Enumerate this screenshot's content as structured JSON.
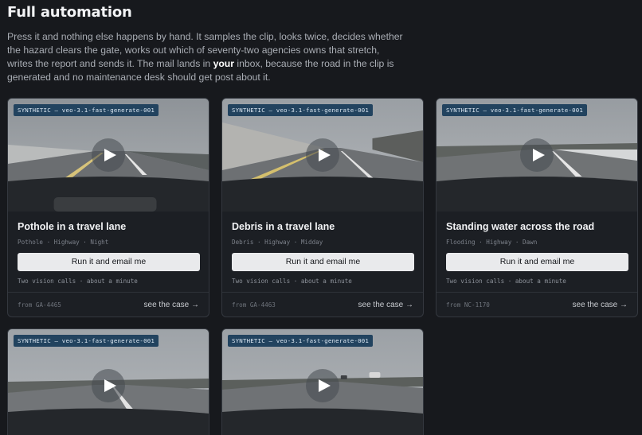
{
  "header": {
    "title": "Full automation",
    "intro_part1": "Press it and nothing else happens by hand. It samples the clip, looks twice, decides whether the hazard clears the gate, works out which of seventy-two agencies owns that stretch, writes the report and sends it. The mail lands in ",
    "intro_bold": "your",
    "intro_part2": " inbox, because the road in the clip is generated and no maintenance desk should get post about it."
  },
  "cards": [
    {
      "badge": "SYNTHETIC — veo-3.1-fast-generate-001",
      "title": "Pothole in a travel lane",
      "tags": "Pothole · Highway · Night",
      "button_label": "Run it and email me",
      "note": "Two vision calls · about a minute",
      "from": "from GA-4465",
      "case_label": "see the case →"
    },
    {
      "badge": "SYNTHETIC — veo-3.1-fast-generate-001",
      "title": "Debris in a travel lane",
      "tags": "Debris · Highway · Midday",
      "button_label": "Run it and email me",
      "note": "Two vision calls · about a minute",
      "from": "from GA-4463",
      "case_label": "see the case →"
    },
    {
      "badge": "SYNTHETIC — veo-3.1-fast-generate-001",
      "title": "Standing water across the road",
      "tags": "Flooding · Highway · Dawn",
      "button_label": "Run it and email me",
      "note": "Two vision calls · about a minute",
      "from": "from NC-1170",
      "case_label": "see the case →"
    },
    {
      "badge": "SYNTHETIC — veo-3.1-fast-generate-001"
    },
    {
      "badge": "SYNTHETIC — veo-3.1-fast-generate-001"
    }
  ],
  "icons": {
    "play": "play-icon"
  },
  "colors": {
    "background": "#17191d",
    "badge": "#22435f",
    "button": "#e9eaec"
  }
}
